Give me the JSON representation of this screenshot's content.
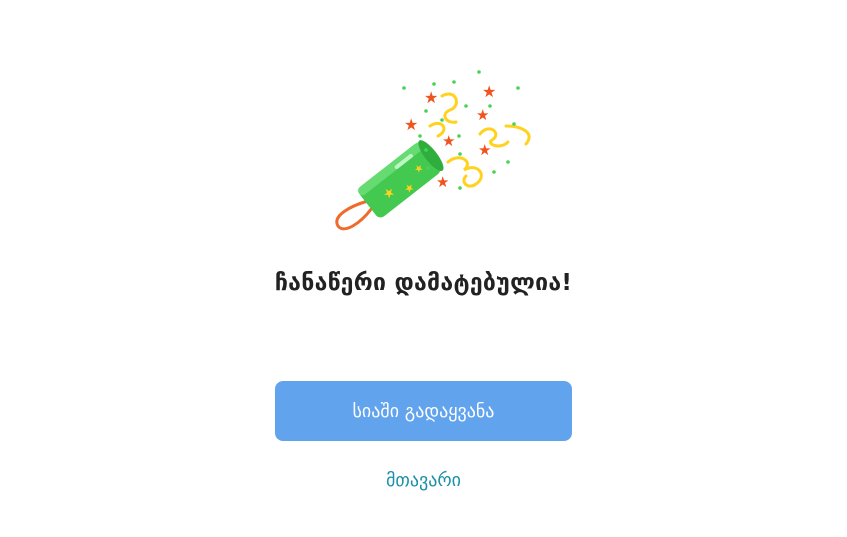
{
  "success": {
    "title": "ჩანაწერი დამატებულია!",
    "illustration_icon": "party-popper-icon"
  },
  "actions": {
    "primary_label": "სიაში გადაყვანა",
    "secondary_label": "მთავარი"
  },
  "colors": {
    "primary_button": "#62A3EE",
    "link": "#1A8FA8",
    "popper_green": "#43C94F",
    "confetti_red": "#F0541E",
    "confetti_yellow": "#FFD21F",
    "string_orange": "#F06A2A",
    "dot_green": "#4CD158"
  }
}
